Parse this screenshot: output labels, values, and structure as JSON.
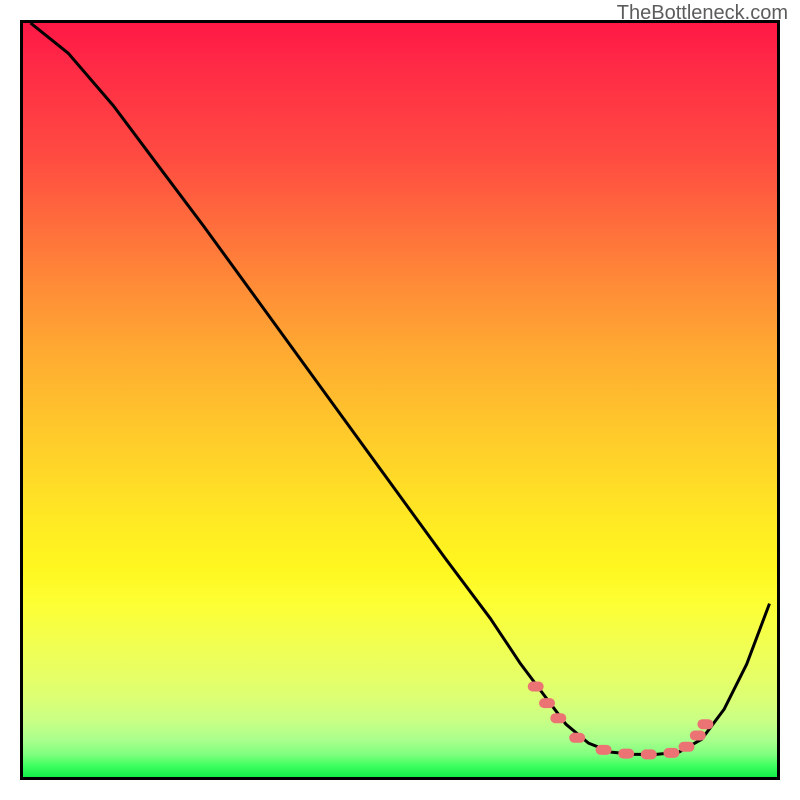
{
  "watermark": "TheBottleneck.com",
  "chart_data": {
    "type": "line",
    "title": "",
    "xlabel": "",
    "ylabel": "",
    "xlim": [
      0,
      100
    ],
    "ylim": [
      0,
      100
    ],
    "grid": false,
    "note": "Axes are unlabeled in the image. Values are read as percentage of plot frame (0 = bottom/left, 100 = top/right). The background is a red→yellow→green gradient indicating bottleneck severity; the black curve descends steeply, has a flat minimum near x≈73–88, then rises.",
    "series": [
      {
        "name": "bottleneck-curve",
        "color": "#000000",
        "x": [
          1,
          6,
          12,
          18,
          24,
          32,
          40,
          48,
          56,
          62,
          66,
          69,
          72,
          75,
          78,
          81,
          84,
          87,
          90,
          93,
          96,
          99
        ],
        "y": [
          100,
          96,
          89,
          81,
          73,
          62,
          51,
          40,
          29,
          21,
          15,
          11,
          7,
          4.5,
          3.3,
          3,
          3,
          3.3,
          5,
          9,
          15,
          23
        ]
      }
    ],
    "highlight_segments": {
      "name": "optimal-range-markers",
      "color": "#eb7374",
      "description": "Short thick salmon segments overlaid on the curve near its minimum, marking the low-bottleneck region.",
      "points_xy": [
        [
          68,
          12
        ],
        [
          69.5,
          9.8
        ],
        [
          71,
          7.8
        ],
        [
          73.5,
          5.2
        ],
        [
          77,
          3.6
        ],
        [
          80,
          3.1
        ],
        [
          83,
          3.0
        ],
        [
          86,
          3.2
        ],
        [
          88,
          4.0
        ],
        [
          89.5,
          5.5
        ],
        [
          90.5,
          7.0
        ]
      ]
    },
    "gradient": {
      "direction": "top-to-bottom",
      "stops": [
        {
          "pos": 0.0,
          "color": "#ff1846"
        },
        {
          "pos": 0.35,
          "color": "#ff8c37"
        },
        {
          "pos": 0.67,
          "color": "#ffec23"
        },
        {
          "pos": 0.92,
          "color": "#c9ff85"
        },
        {
          "pos": 1.0,
          "color": "#13f04a"
        }
      ]
    }
  }
}
